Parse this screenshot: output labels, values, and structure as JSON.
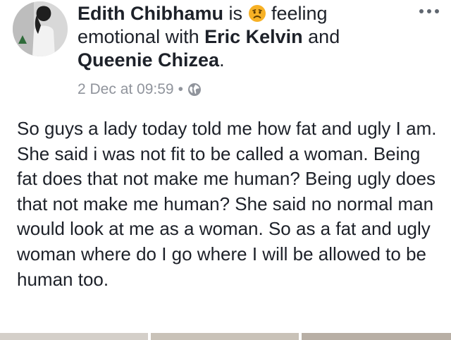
{
  "post": {
    "author": "Edith Chibhamu",
    "is_text": " is ",
    "feeling_text": " feeling emotional with ",
    "tagged_1": "Eric Kelvin",
    "and_text": " and ",
    "tagged_2": "Queenie Chizea",
    "period": ".",
    "timestamp": "2 Dec at 09:59",
    "separator": "•",
    "privacy_icon": "globe-icon",
    "feeling_icon": "sad-face-icon",
    "body": "So guys a lady today told me how fat and ugly I am. She said i was not fit to be called a woman.  Being fat does that not make me human? Being ugly does that not make me human? She said no normal man would look at me as a woman. So as a fat and ugly woman where do I go where I will be allowed to be human too."
  },
  "colors": {
    "text": "#1d2129",
    "meta": "#90949c",
    "emoji": "#f7b125"
  }
}
